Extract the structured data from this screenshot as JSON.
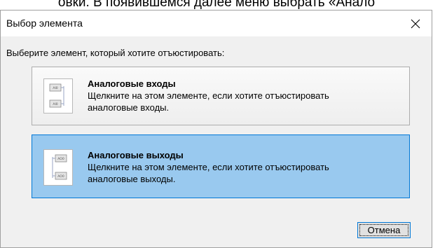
{
  "background_caption": "овки. В появившемся далее меню выбрать «Анало",
  "dialog": {
    "title": "Выбор элемента",
    "close_glyph": "✕",
    "prompt": "Выберите элемент, который хотите отъюстировать:",
    "options": [
      {
        "title": "Аналоговые входы",
        "description": "Щелкните на этом элементе, если хотите отъюстировать аналоговые входы.",
        "icon": "analog-inputs-icon",
        "selected": false,
        "thumb_labels": [
          "AI0",
          "AI0"
        ]
      },
      {
        "title": "Аналоговые выходы",
        "description": "Щелкните на этом элементе, если хотите отъюстировать аналоговые выходы.",
        "icon": "analog-outputs-icon",
        "selected": true,
        "thumb_labels": [
          "AO0",
          "AO0"
        ]
      }
    ],
    "cancel_label": "Отмена"
  },
  "colors": {
    "selected_fill": "#99c9ef",
    "selected_border": "#0078d7",
    "dialog_bg": "#f0f0f0"
  }
}
